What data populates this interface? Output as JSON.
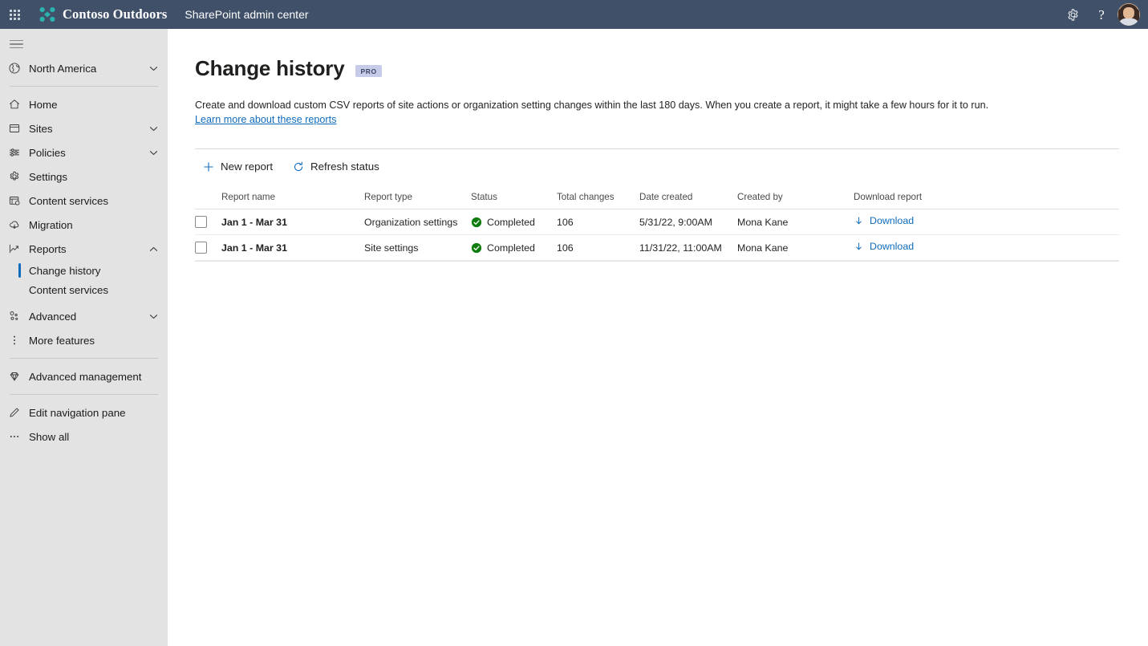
{
  "suite": {
    "waffle_label": "App launcher",
    "brand": "Contoso Outdoors",
    "subtitle": "SharePoint admin center",
    "settings_label": "Settings",
    "help_label": "?",
    "account_label": "Account manager"
  },
  "nav": {
    "hamburger_label": "Collapse navigation",
    "tenant": {
      "label": "North America",
      "icon": "globe-icon"
    },
    "items": [
      {
        "label": "Home",
        "icon": "home-icon",
        "expandable": false
      },
      {
        "label": "Sites",
        "icon": "sites-icon",
        "expandable": true
      },
      {
        "label": "Policies",
        "icon": "policies-icon",
        "expandable": true
      },
      {
        "label": "Settings",
        "icon": "gear-icon",
        "expandable": false
      },
      {
        "label": "Content services",
        "icon": "content-services-icon",
        "expandable": false
      },
      {
        "label": "Migration",
        "icon": "migration-icon",
        "expandable": false
      },
      {
        "label": "Reports",
        "icon": "reports-icon",
        "expandable": true,
        "expanded": true
      }
    ],
    "reports_children": [
      {
        "label": "Change history",
        "selected": true
      },
      {
        "label": "Content services",
        "selected": false
      }
    ],
    "items_after": [
      {
        "label": "Advanced",
        "icon": "advanced-icon",
        "expandable": true
      },
      {
        "label": "More features",
        "icon": "more-features-icon",
        "expandable": false
      }
    ],
    "advanced_management": {
      "label": "Advanced management",
      "icon": "diamond-icon"
    },
    "edit_nav": {
      "label": "Edit navigation pane",
      "icon": "pencil-icon"
    },
    "show_all": {
      "label": "Show all",
      "icon": "ellipsis-icon"
    }
  },
  "page": {
    "title": "Change history",
    "badge": "PRO",
    "description": "Create and download custom CSV reports of site actions or organization setting changes within the last 180 days. When you create a report, it might take a few hours for it to run.",
    "learn_more": "Learn more about these reports"
  },
  "toolbar": {
    "new_report": "New report",
    "refresh_status": "Refresh status"
  },
  "table": {
    "columns": {
      "name": "Report name",
      "type": "Report type",
      "status": "Status",
      "total": "Total changes",
      "date": "Date created",
      "by": "Created by",
      "download": "Download report"
    },
    "rows": [
      {
        "name": "Jan 1 - Mar 31",
        "type": "Organization settings",
        "status": "Completed",
        "total": "106",
        "date": "5/31/22, 9:00AM",
        "by": "Mona Kane",
        "download": "Download",
        "checked": false
      },
      {
        "name": "Jan 1 - Mar 31",
        "type": "Site settings",
        "status": "Completed",
        "total": "106",
        "date": "11/31/22, 11:00AM",
        "by": "Mona Kane",
        "download": "Download",
        "checked": false
      }
    ]
  },
  "colors": {
    "suite_bar": "#3f5068",
    "nav_bg": "#e3e3e3",
    "accent": "#0f6cbd",
    "success": "#107c10",
    "badge_bg": "#c5cbe8",
    "brand_logo": "#2bb3b0"
  }
}
